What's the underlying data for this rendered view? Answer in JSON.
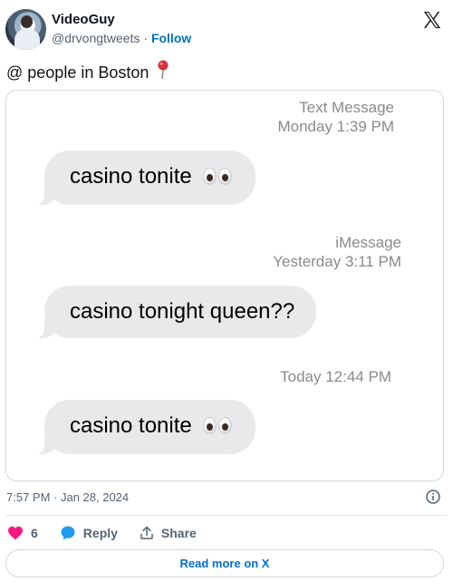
{
  "user": {
    "display_name": "VideoGuy",
    "handle": "@drvongtweets",
    "separator": " · ",
    "follow_label": "Follow"
  },
  "tweet": {
    "text": "@ people in Boston",
    "emoji_icon": "round-pushpin-icon",
    "timestamp": "7:57 PM · Jan 28, 2024"
  },
  "conversation": {
    "blocks": [
      {
        "service": "Text Message",
        "time": "Monday 1:39 PM",
        "message": "casino  tonite",
        "emoji_icon": "eyes-emoji-icon"
      },
      {
        "service": "iMessage",
        "time": "Yesterday 3:11 PM",
        "message": "casino tonight queen??",
        "emoji_icon": ""
      },
      {
        "service": "",
        "time": "Today 12:44 PM",
        "message": "casino  tonite",
        "emoji_icon": "eyes-emoji-icon"
      }
    ],
    "bubble_color": "#e9e9eb",
    "meta_color": "#8a8a8e"
  },
  "actions": {
    "like_count": "6",
    "reply_label": "Reply",
    "share_label": "Share",
    "like_color": "#f91880",
    "reply_color": "#1d9bf0"
  },
  "read_more_label": "Read more on X",
  "accent_link_color": "#0074b7"
}
